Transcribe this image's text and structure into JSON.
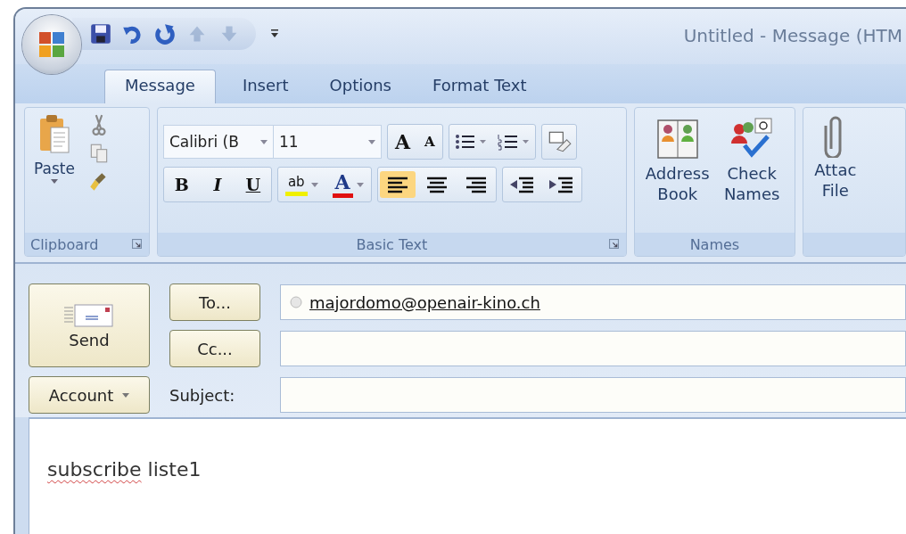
{
  "window": {
    "title": "Untitled - Message (HTM"
  },
  "quick_access": [
    {
      "kind": "save",
      "disabled": false
    },
    {
      "kind": "undo",
      "disabled": false
    },
    {
      "kind": "redo",
      "disabled": false
    },
    {
      "kind": "up",
      "disabled": true
    },
    {
      "kind": "down",
      "disabled": true
    }
  ],
  "tabs": [
    {
      "label": "Message",
      "selected": true
    },
    {
      "label": "Insert",
      "selected": false
    },
    {
      "label": "Options",
      "selected": false
    },
    {
      "label": "Format Text",
      "selected": false
    }
  ],
  "clipboard": {
    "label": "Clipboard",
    "paste": "Paste"
  },
  "basic_text": {
    "label": "Basic Text",
    "font": "Calibri (B",
    "size": "11",
    "grow": "A",
    "shrink": "A",
    "bold": "B",
    "italic": "I",
    "underline": "U",
    "highlight": "ab",
    "font_color": "A",
    "align": [
      {
        "kind": "left",
        "selected": true
      },
      {
        "kind": "center",
        "selected": false
      },
      {
        "kind": "right",
        "selected": false
      }
    ]
  },
  "names": {
    "label": "Names",
    "buttons": [
      {
        "kind": "book",
        "label": "Address Book"
      },
      {
        "kind": "check",
        "label": "Check Names"
      }
    ]
  },
  "attach": {
    "label": "Attac File"
  },
  "header": {
    "send": "Send",
    "to": "To...",
    "cc": "Cc...",
    "account": "Account",
    "subject_label": "Subject:",
    "to_value": "majordomo@openair-kino.ch"
  },
  "body": {
    "words": [
      {
        "text": "subscribe",
        "misspelled": true
      },
      {
        "text": "liste1",
        "misspelled": false
      }
    ]
  }
}
